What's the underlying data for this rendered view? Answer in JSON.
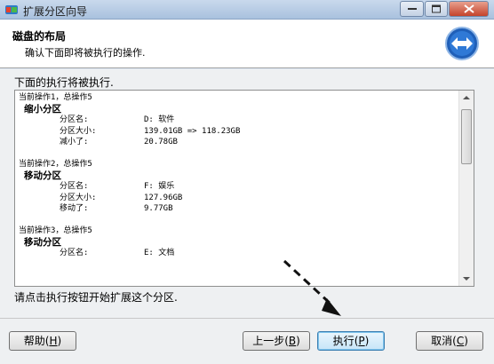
{
  "window": {
    "title": "扩展分区向导"
  },
  "header": {
    "title": "磁盘的布局",
    "subtitle": "确认下面即将被执行的操作."
  },
  "body": {
    "intro": "下面的执行将被执行.",
    "bottom_note": "请点击执行按钮开始扩展这个分区."
  },
  "operations": [
    {
      "head": "当前操作1，总操作5",
      "type": "缩小分区",
      "rows": [
        {
          "k": "分区名:",
          "v": "D: 软件"
        },
        {
          "k": "分区大小:",
          "v": "139.01GB => 118.23GB"
        },
        {
          "k": "减小了:",
          "v": "20.78GB"
        }
      ]
    },
    {
      "head": "当前操作2，总操作5",
      "type": "移动分区",
      "rows": [
        {
          "k": "分区名:",
          "v": "F: 娱乐"
        },
        {
          "k": "分区大小:",
          "v": "127.96GB"
        },
        {
          "k": "移动了:",
          "v": "9.77GB"
        }
      ]
    },
    {
      "head": "当前操作3，总操作5",
      "type": "移动分区",
      "rows": [
        {
          "k": "分区名:",
          "v": "E: 文档"
        }
      ]
    }
  ],
  "buttons": {
    "help": "帮助",
    "help_key": "H",
    "prev": "上一步",
    "prev_key": "B",
    "exec": "执行",
    "exec_key": "P",
    "cancel": "取消",
    "cancel_key": "C"
  },
  "icons": {
    "app": "partition-icon",
    "header": "resize-arrows-icon"
  }
}
